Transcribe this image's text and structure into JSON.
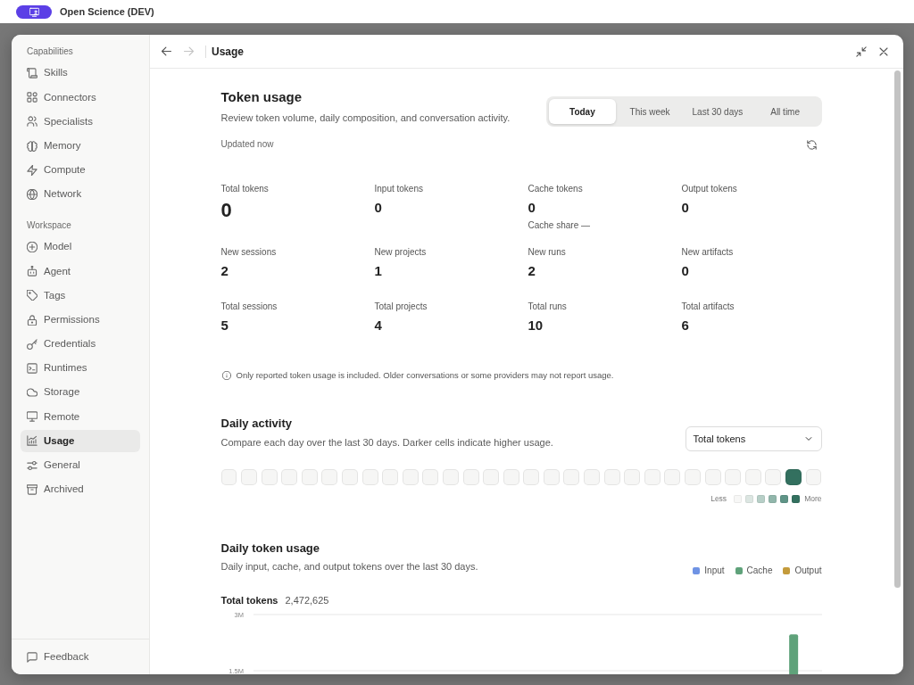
{
  "app_bar": {
    "title": "Open Science (DEV)"
  },
  "sidebar": {
    "sections": [
      {
        "heading": "Capabilities",
        "items": [
          {
            "label": "Skills",
            "selected": false
          },
          {
            "label": "Connectors",
            "selected": false
          },
          {
            "label": "Specialists",
            "selected": false
          },
          {
            "label": "Memory",
            "selected": false
          },
          {
            "label": "Compute",
            "selected": false
          },
          {
            "label": "Network",
            "selected": false
          }
        ]
      },
      {
        "heading": "Workspace",
        "items": [
          {
            "label": "Model",
            "selected": false
          },
          {
            "label": "Agent",
            "selected": false
          },
          {
            "label": "Tags",
            "selected": false
          },
          {
            "label": "Permissions",
            "selected": false
          },
          {
            "label": "Credentials",
            "selected": false
          },
          {
            "label": "Runtimes",
            "selected": false
          },
          {
            "label": "Storage",
            "selected": false
          },
          {
            "label": "Remote",
            "selected": false
          },
          {
            "label": "Usage",
            "selected": true
          },
          {
            "label": "General",
            "selected": false
          },
          {
            "label": "Archived",
            "selected": false
          }
        ]
      }
    ],
    "footer": {
      "label": "Feedback"
    }
  },
  "header": {
    "title": "Usage",
    "nav": [
      {
        "kind": "back",
        "disabled": false
      },
      {
        "kind": "forward",
        "disabled": true
      }
    ]
  },
  "token_usage": {
    "title": "Token usage",
    "subtitle": "Review token volume, daily composition, and conversation activity.",
    "ranges": [
      {
        "label": "Today",
        "selected": true
      },
      {
        "label": "This week",
        "selected": false
      },
      {
        "label": "Last 30 days",
        "selected": false
      },
      {
        "label": "All time",
        "selected": false
      }
    ],
    "updated": "Updated now",
    "stats": [
      {
        "label": "Total tokens",
        "value": "0",
        "kind": "headline"
      },
      {
        "label": "Input tokens",
        "value": "0",
        "kind": "regular"
      },
      {
        "label": "Cache tokens",
        "value": "0",
        "kind": "regular",
        "detail": "Cache share —"
      },
      {
        "label": "Output tokens",
        "value": "0",
        "kind": "regular"
      },
      {
        "label": "New sessions",
        "value": "2",
        "kind": "regular"
      },
      {
        "label": "New projects",
        "value": "1",
        "kind": "regular"
      },
      {
        "label": "New runs",
        "value": "2",
        "kind": "regular"
      },
      {
        "label": "New artifacts",
        "value": "0",
        "kind": "regular"
      },
      {
        "label": "Total sessions",
        "value": "5",
        "kind": "regular"
      },
      {
        "label": "Total projects",
        "value": "4",
        "kind": "regular"
      },
      {
        "label": "Total runs",
        "value": "10",
        "kind": "regular"
      },
      {
        "label": "Total artifacts",
        "value": "6",
        "kind": "regular"
      }
    ],
    "note": "Only reported token usage is included. Older conversations or some providers may not report usage."
  },
  "daily_activity": {
    "title": "Daily activity",
    "subtitle": "Compare each day over the last 30 days. Darker cells indicate higher usage.",
    "metric_select": {
      "value": "Total tokens"
    },
    "cells": [
      {
        "color": "#f6f6f5"
      },
      {
        "color": "#f6f6f5"
      },
      {
        "color": "#f6f6f5"
      },
      {
        "color": "#f6f6f5"
      },
      {
        "color": "#f6f6f5"
      },
      {
        "color": "#f6f6f5"
      },
      {
        "color": "#f6f6f5"
      },
      {
        "color": "#f6f6f5"
      },
      {
        "color": "#f6f6f5"
      },
      {
        "color": "#f6f6f5"
      },
      {
        "color": "#f6f6f5"
      },
      {
        "color": "#f6f6f5"
      },
      {
        "color": "#f6f6f5"
      },
      {
        "color": "#f6f6f5"
      },
      {
        "color": "#f6f6f5"
      },
      {
        "color": "#f6f6f5"
      },
      {
        "color": "#f6f6f5"
      },
      {
        "color": "#f6f6f5"
      },
      {
        "color": "#f6f6f5"
      },
      {
        "color": "#f6f6f5"
      },
      {
        "color": "#f6f6f5"
      },
      {
        "color": "#f6f6f5"
      },
      {
        "color": "#f6f6f5"
      },
      {
        "color": "#f6f6f5"
      },
      {
        "color": "#f6f6f5"
      },
      {
        "color": "#f6f6f5"
      },
      {
        "color": "#f6f6f5"
      },
      {
        "color": "#f6f6f5"
      },
      {
        "color": "#33705f"
      },
      {
        "color": "#f6f6f5"
      }
    ],
    "legend": {
      "less": "Less",
      "more": "More",
      "steps": [
        {
          "color": "#f7f7f6"
        },
        {
          "color": "#dce6e2"
        },
        {
          "color": "#b7cfc7"
        },
        {
          "color": "#91b6ab"
        },
        {
          "color": "#5f9487"
        },
        {
          "color": "#33705f"
        }
      ]
    }
  },
  "daily_token_usage": {
    "title": "Daily token usage",
    "subtitle": "Daily input, cache, and output tokens over the last 30 days.",
    "total_label": "Total tokens",
    "total_value": "2,472,625",
    "chart_data": {
      "type": "bar",
      "stacked": true,
      "ylim": [
        0,
        3000000
      ],
      "yticks": [
        {
          "value": 3000000,
          "label": "3M"
        },
        {
          "value": 1500000,
          "label": "1.5M"
        }
      ],
      "series": [
        {
          "name": "Input",
          "color": "#6f93e4",
          "values": [
            0,
            0,
            0,
            0,
            0,
            0,
            0,
            0,
            0,
            0,
            0,
            0,
            0,
            0,
            0,
            0,
            0,
            0,
            0,
            0,
            0,
            0,
            0,
            0,
            0,
            0,
            0,
            0,
            0,
            0
          ]
        },
        {
          "name": "Cache",
          "color": "#5fa27a",
          "values": [
            0,
            0,
            0,
            0,
            0,
            0,
            0,
            0,
            0,
            0,
            0,
            0,
            0,
            0,
            0,
            0,
            0,
            0,
            0,
            0,
            0,
            0,
            0,
            0,
            0,
            0,
            0,
            0,
            2470000,
            0
          ]
        },
        {
          "name": "Output",
          "color": "#c49b3b",
          "values": [
            0,
            0,
            0,
            0,
            0,
            0,
            0,
            0,
            0,
            0,
            0,
            0,
            0,
            0,
            0,
            0,
            0,
            0,
            0,
            0,
            0,
            0,
            0,
            0,
            0,
            0,
            0,
            0,
            0,
            0
          ]
        }
      ]
    }
  }
}
